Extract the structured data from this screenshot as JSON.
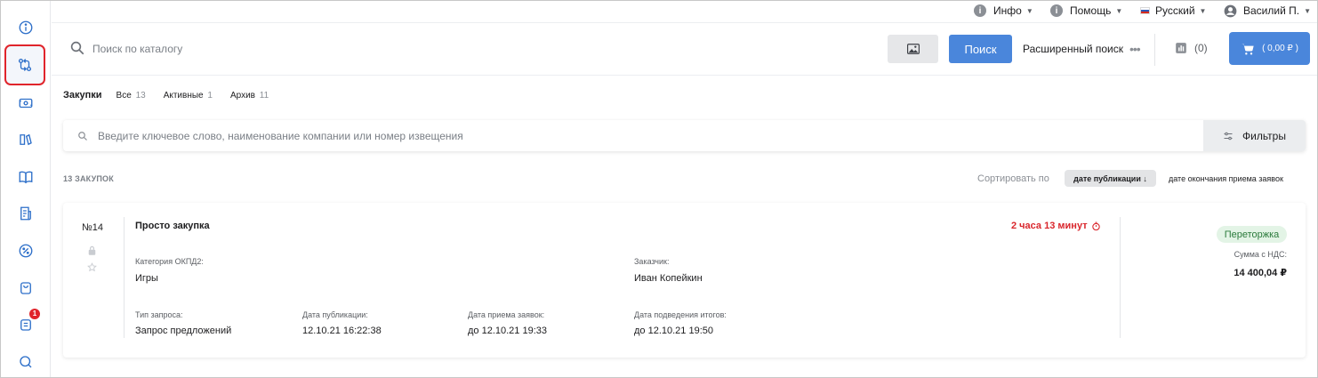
{
  "topbar": {
    "info_label": "Инфо",
    "help_label": "Помощь",
    "language_label": "Русский",
    "user_label": "Василий П."
  },
  "header": {
    "search_placeholder": "Поиск по каталогу",
    "search_button": "Поиск",
    "advanced_search": "Расширенный поиск",
    "compare_count": "(0)",
    "cart_amount": "( 0,00 ₽ )"
  },
  "sidebar": {
    "notification_badge": "1"
  },
  "tabs": {
    "title": "Закупки",
    "items": [
      {
        "label": "Все",
        "count": "13"
      },
      {
        "label": "Активные",
        "count": "1"
      },
      {
        "label": "Архив",
        "count": "11"
      }
    ]
  },
  "filter": {
    "placeholder": "Введите ключевое слово, наименование компании или номер извещения",
    "button": "Фильтры"
  },
  "list": {
    "count_label": "13 ЗАКУПОК",
    "sort_label": "Сортировать по",
    "sort_active": "дате публикации ↓",
    "sort_alt": "дате окончания приема заявок"
  },
  "card": {
    "number": "№14",
    "title": "Просто закупка",
    "timer": "2 часа 13 минут",
    "category_label": "Категория ОКПД2:",
    "category_value": "Игры",
    "customer_label": "Заказчик:",
    "customer_value": "Иван Копейкин",
    "request_type_label": "Тип запроса:",
    "request_type_value": "Запрос предложений",
    "pub_date_label": "Дата публикации:",
    "pub_date_value": "12.10.21 16:22:38",
    "accept_label": "Дата приема заявок:",
    "accept_value": "до 12.10.21 19:33",
    "results_label": "Дата подведения итогов:",
    "results_value": "до 12.10.21 19:50",
    "status": "Переторжка",
    "sum_label": "Сумма с НДС:",
    "sum_value": "14 400,04 ₽"
  }
}
